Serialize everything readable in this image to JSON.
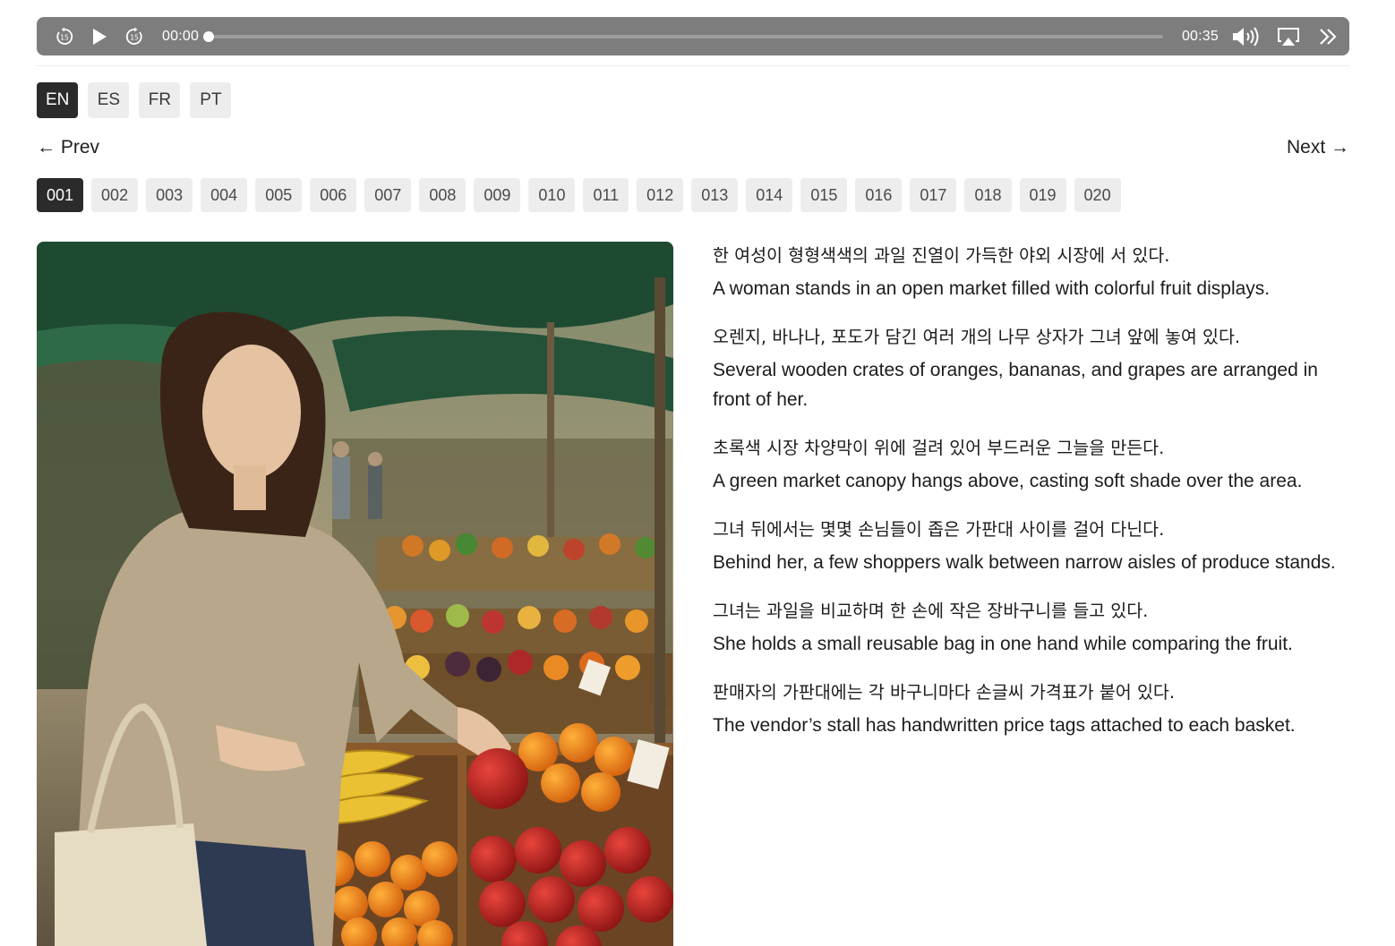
{
  "player": {
    "rewind_icon": "rewind-15-icon",
    "play_icon": "play-icon",
    "forward_icon": "forward-15-icon",
    "current_time": "00:00",
    "total_time": "00:35",
    "progress_fraction": 0,
    "volume_icon": "volume-icon",
    "cast_icon": "airplay-icon",
    "more_icon": "chevrons-right-icon"
  },
  "languages": [
    {
      "label": "EN",
      "active": true
    },
    {
      "label": "ES",
      "active": false
    },
    {
      "label": "FR",
      "active": false
    },
    {
      "label": "PT",
      "active": false
    }
  ],
  "nav": {
    "prev_label": "← Prev",
    "next_label": "Next →"
  },
  "pages": [
    {
      "label": "001",
      "active": true
    },
    {
      "label": "002",
      "active": false
    },
    {
      "label": "003",
      "active": false
    },
    {
      "label": "004",
      "active": false
    },
    {
      "label": "005",
      "active": false
    },
    {
      "label": "006",
      "active": false
    },
    {
      "label": "007",
      "active": false
    },
    {
      "label": "008",
      "active": false
    },
    {
      "label": "009",
      "active": false
    },
    {
      "label": "010",
      "active": false
    },
    {
      "label": "011",
      "active": false
    },
    {
      "label": "012",
      "active": false
    },
    {
      "label": "013",
      "active": false
    },
    {
      "label": "014",
      "active": false
    },
    {
      "label": "015",
      "active": false
    },
    {
      "label": "016",
      "active": false
    },
    {
      "label": "017",
      "active": false
    },
    {
      "label": "018",
      "active": false
    },
    {
      "label": "019",
      "active": false
    },
    {
      "label": "020",
      "active": false
    }
  ],
  "lines": [
    {
      "ko": "한 여성이 형형색색의 과일 진열이 가득한 야외 시장에 서 있다.",
      "en": "A woman stands in an open market filled with colorful fruit displays."
    },
    {
      "ko": "오렌지, 바나나, 포도가 담긴 여러 개의 나무 상자가 그녀 앞에 놓여 있다.",
      "en": "Several wooden crates of oranges, bananas, and grapes are arranged in front of her."
    },
    {
      "ko": "초록색 시장 차양막이 위에 걸려 있어 부드러운 그늘을 만든다.",
      "en": "A green market canopy hangs above, casting soft shade over the area."
    },
    {
      "ko": "그녀 뒤에서는 몇몇 손님들이 좁은 가판대 사이를 걸어 다닌다.",
      "en": "Behind her, a few shoppers walk between narrow aisles of produce stands."
    },
    {
      "ko": "그녀는 과일을 비교하며 한 손에 작은 장바구니를 들고 있다.",
      "en": "She holds a small reusable bag in one hand while comparing the fruit."
    },
    {
      "ko": "판매자의 가판대에는 각 바구니마다 손글씨 가격표가 붙어 있다.",
      "en": "The vendor’s stall has handwritten price tags attached to each basket."
    }
  ],
  "colors": {
    "player_bg": "#7d7d7d",
    "chip_active": "#2b2b2b",
    "chip_idle": "#ededed"
  }
}
